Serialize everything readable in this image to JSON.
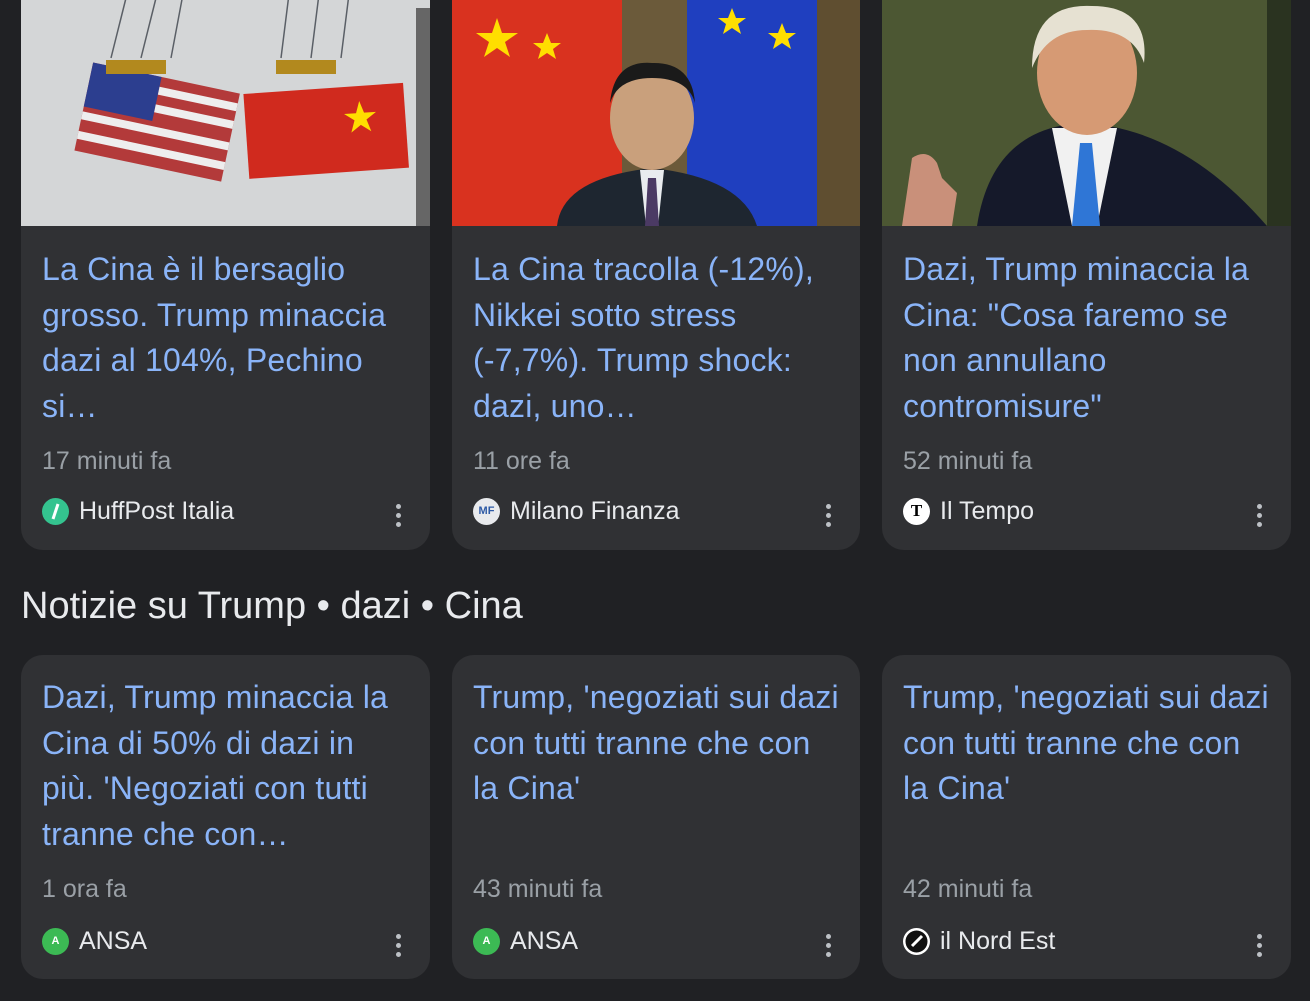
{
  "top_stories": [
    {
      "title": "La Cina è il bersaglio grosso. Trump minaccia dazi al 104%, Pechino si…",
      "time": "17 minuti fa",
      "source": "HuffPost Italia",
      "logo_color": "#34c38f"
    },
    {
      "title": "La Cina tracolla (-12%), Nikkei sotto stress (-7,7%). Trump shock: dazi, uno…",
      "time": "11 ore fa",
      "source": "Milano Finanza",
      "logo_text": "MF",
      "logo_color": "#2d5aa6"
    },
    {
      "title": "Dazi, Trump minaccia la Cina: \"Cosa faremo se non annullano contromisure\"",
      "time": "52 minuti fa",
      "source": "Il Tempo",
      "logo_text": "T",
      "logo_color": "#ffffff"
    }
  ],
  "section": {
    "title": "Notizie su Trump • dazi • Cina"
  },
  "news": [
    {
      "title": "Dazi, Trump minaccia la Cina di 50% di dazi in più. 'Negoziati con tutti tranne che con…",
      "time": "1 ora fa",
      "source": "ANSA",
      "logo_text": "A",
      "logo_color": "#3cba54"
    },
    {
      "title": "Trump, 'negoziati sui dazi con tutti tranne che con la Cina'",
      "time": "43 minuti fa",
      "source": "ANSA",
      "logo_text": "A",
      "logo_color": "#3cba54"
    },
    {
      "title": "Trump, 'negoziati sui dazi con tutti tranne che con la Cina'",
      "time": "42 minuti fa",
      "source": "il Nord Est",
      "logo_color": "#ffffff"
    }
  ],
  "colors": {
    "background": "#202124",
    "card": "#303134",
    "title": "#8ab4f8",
    "meta": "#9aa0a6"
  }
}
